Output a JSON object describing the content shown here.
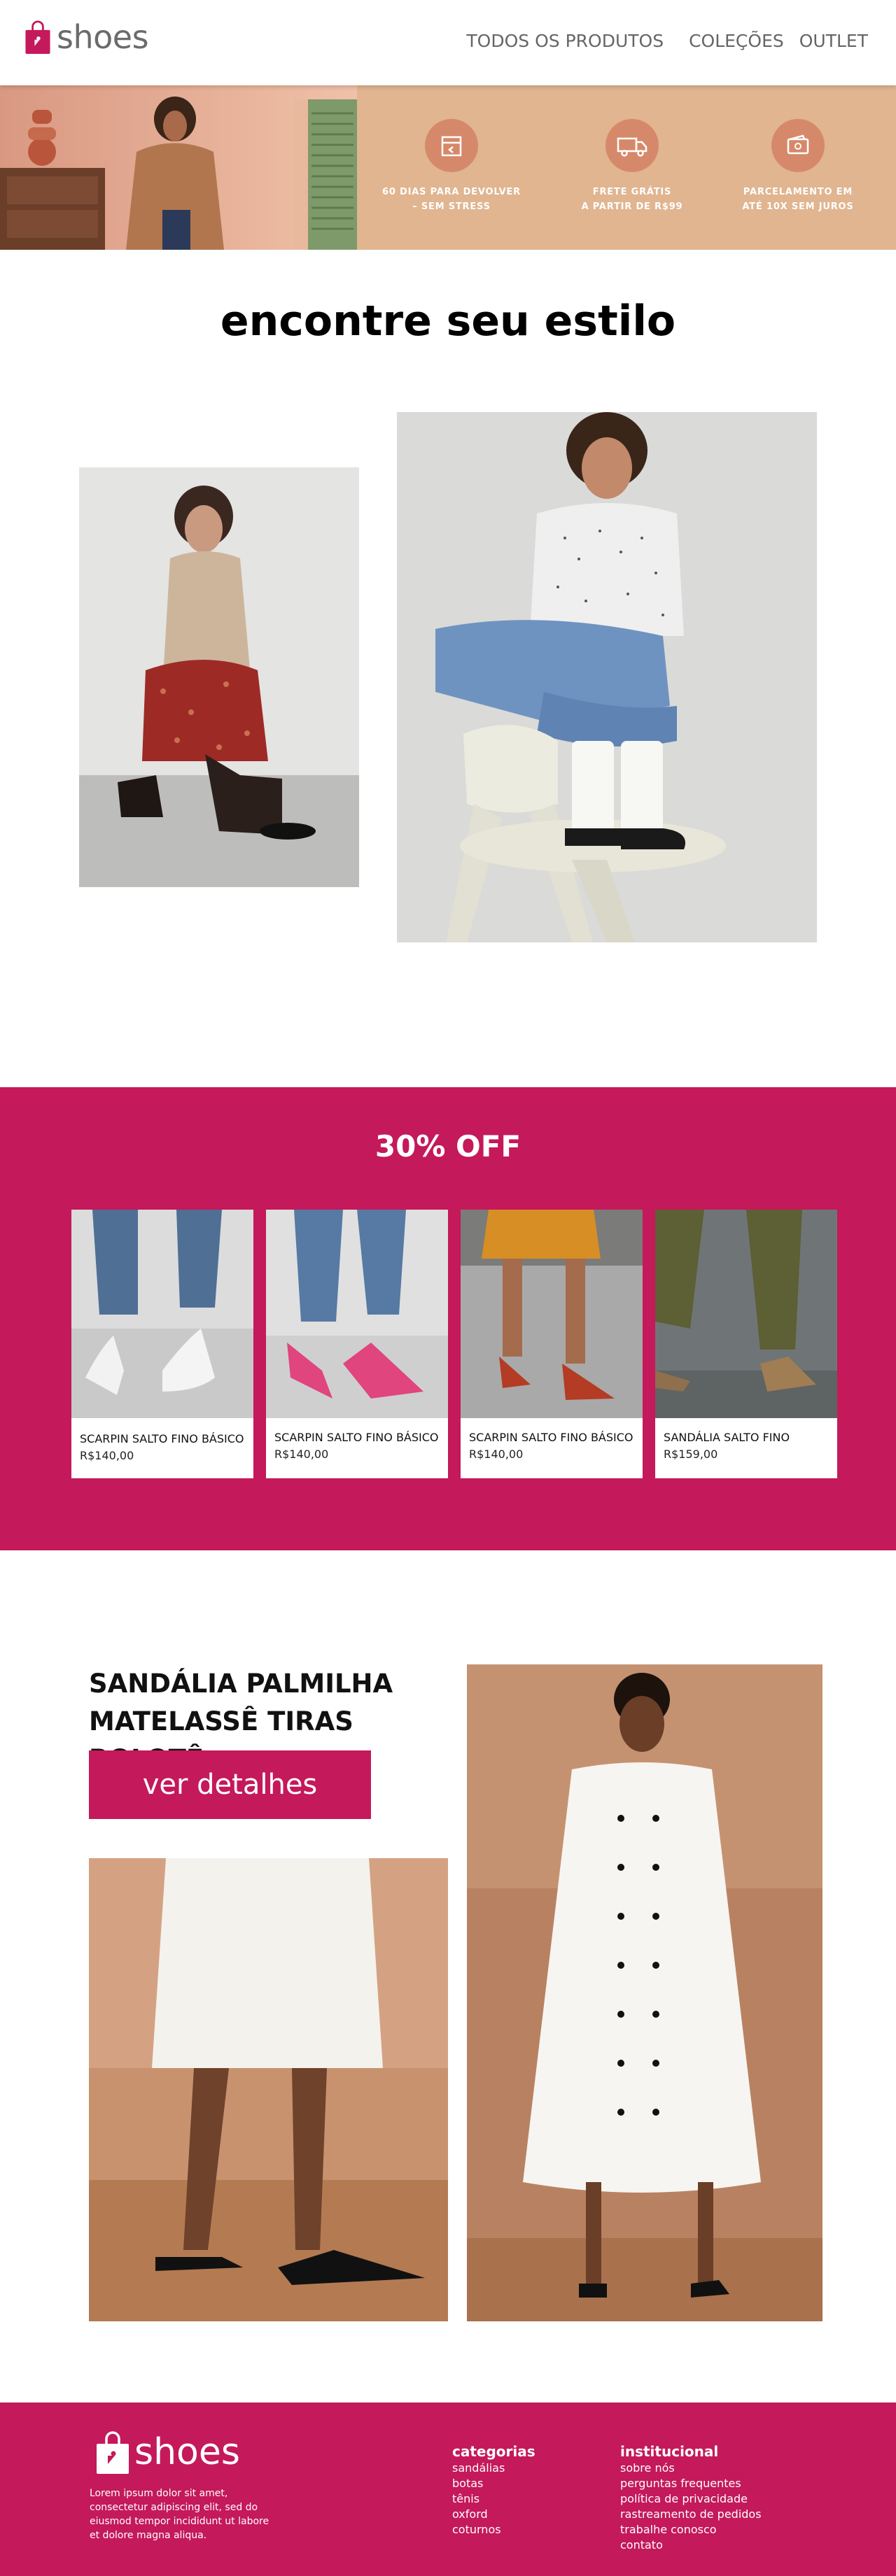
{
  "header": {
    "logo_text": "shoes",
    "nav": [
      "TODOS OS PRODUTOS",
      "COLEÇÕES",
      "OUTLET"
    ]
  },
  "banner": {
    "benefits": [
      {
        "line1": "60 DIAS PARA DEVOLVER",
        "line2": "– SEM STRESS",
        "icon": "box-return-icon"
      },
      {
        "line1": "FRETE GRÁTIS",
        "line2": "A PARTIR DE R$99",
        "icon": "delivery-truck-icon"
      },
      {
        "line1": "PARCELAMENTO EM",
        "line2": "ATÉ 10X SEM JUROS",
        "icon": "wallet-icon"
      }
    ]
  },
  "style_section": {
    "title": "encontre seu estilo"
  },
  "offer": {
    "title": "30% OFF",
    "products": [
      {
        "name": "SCARPIN SALTO FINO BÁSICO",
        "price": "R$140,00"
      },
      {
        "name": "SCARPIN SALTO FINO BÁSICO",
        "price": "R$140,00"
      },
      {
        "name": "SCARPIN SALTO FINO BÁSICO",
        "price": "R$140,00"
      },
      {
        "name": "SANDÁLIA SALTO FINO",
        "price": "R$159,00"
      }
    ]
  },
  "feature": {
    "title_line1": "SANDÁLIA PALMILHA",
    "title_line2": "MATELASSÊ TIRAS ROLOTÊ",
    "button": "ver detalhes"
  },
  "footer": {
    "logo_text": "shoes",
    "description": "Lorem ipsum dolor sit amet, consectetur adipiscing elit, sed do eiusmod tempor incididunt ut labore et dolore magna aliqua.",
    "categories": {
      "title": "categorias",
      "links": [
        "sandálias",
        "botas",
        "tênis",
        "oxford",
        "coturnos"
      ]
    },
    "institutional": {
      "title": "institucional",
      "links": [
        "sobre nós",
        "perguntas frequentes",
        "política de privacidade",
        "rastreamento de pedidos",
        "trabalhe conosco",
        "contato"
      ]
    }
  },
  "colors": {
    "brand": "#c4195a",
    "banner_bg": "#e0b590",
    "banner_icon": "#d6896a",
    "nav_text": "#666666"
  }
}
